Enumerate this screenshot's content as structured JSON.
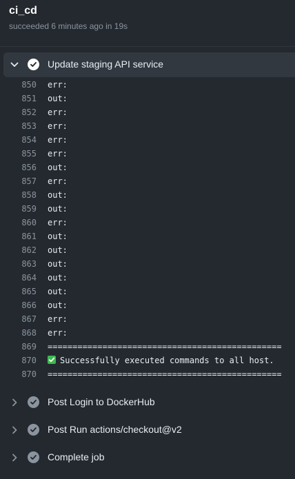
{
  "job": {
    "title": "ci_cd",
    "subtitle": "succeeded 6 minutes ago in 19s"
  },
  "expanded_step": {
    "label": "Update staging API service",
    "icon": "chevron-down-icon",
    "status_icon": "check-circle-icon",
    "log_lines": [
      {
        "num": "850",
        "text": "err:"
      },
      {
        "num": "851",
        "text": "out:"
      },
      {
        "num": "852",
        "text": "err:"
      },
      {
        "num": "853",
        "text": "err:"
      },
      {
        "num": "854",
        "text": "err:"
      },
      {
        "num": "855",
        "text": "err:"
      },
      {
        "num": "856",
        "text": "out:"
      },
      {
        "num": "857",
        "text": "err:"
      },
      {
        "num": "858",
        "text": "out:"
      },
      {
        "num": "859",
        "text": "out:"
      },
      {
        "num": "860",
        "text": "err:"
      },
      {
        "num": "861",
        "text": "out:"
      },
      {
        "num": "862",
        "text": "out:"
      },
      {
        "num": "863",
        "text": "out:"
      },
      {
        "num": "864",
        "text": "out:"
      },
      {
        "num": "865",
        "text": "out:"
      },
      {
        "num": "866",
        "text": "out:"
      },
      {
        "num": "867",
        "text": "err:"
      },
      {
        "num": "868",
        "text": "err:"
      },
      {
        "num": "869",
        "text": "==============================================="
      },
      {
        "num": "870",
        "text": "Successfully executed commands to all host.",
        "emoji": "white-check-mark-icon"
      },
      {
        "num": "870",
        "text": "==============================================="
      }
    ]
  },
  "collapsed_steps": [
    {
      "label": "Post Login to DockerHub"
    },
    {
      "label": "Post Run actions/checkout@v2"
    },
    {
      "label": "Complete job"
    }
  ],
  "colors": {
    "background": "#24292f",
    "expanded_row": "#32383f",
    "success": "#3fb950",
    "muted": "#8b949e"
  }
}
